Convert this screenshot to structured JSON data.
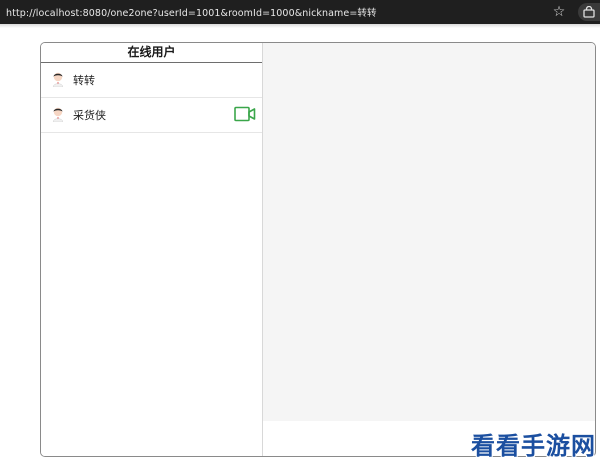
{
  "browser": {
    "url": "http://localhost:8080/one2one?userId=1001&roomId=1000&nickname=转转",
    "bookmark_icon": "star-icon",
    "extension_icon": "extension-icon"
  },
  "sidebar": {
    "title": "在线用户",
    "users": [
      {
        "name": "转转",
        "has_call_button": false
      },
      {
        "name": "采货侠",
        "has_call_button": true
      }
    ]
  },
  "watermark": "看看手游网",
  "colors": {
    "accent_green": "#3aa64a",
    "chat_background": "#f5f5f5",
    "watermark_blue": "#1b4fa0"
  }
}
